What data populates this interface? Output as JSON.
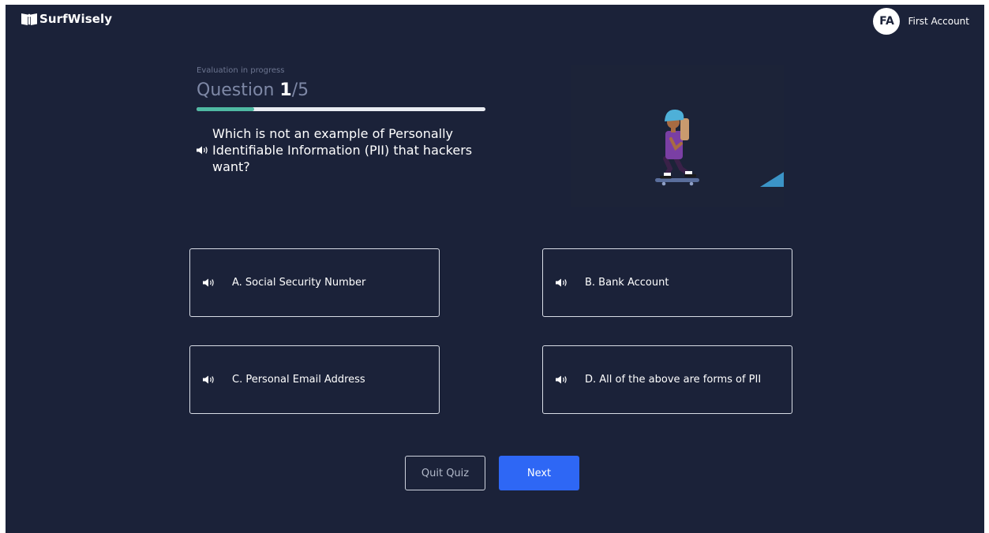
{
  "brand": {
    "name": "SurfWisely"
  },
  "user": {
    "initials": "FA",
    "name": "First Account"
  },
  "quiz": {
    "status": "Evaluation in progress",
    "question_label": "Question ",
    "current": "1",
    "separator": "/",
    "total": "5",
    "progress_fraction": 0.2,
    "question": "Which is not an example of Personally Identifiable Information (PII) that hackers want?"
  },
  "options": [
    {
      "label": "A. Social Security Number"
    },
    {
      "label": "B. Bank Account"
    },
    {
      "label": "C. Personal Email Address"
    },
    {
      "label": "D. All of the above are forms of PII"
    }
  ],
  "buttons": {
    "quit": "Quit Quiz",
    "next": "Next"
  },
  "icons": {
    "speaker": "speaker-icon",
    "logo": "logo-icon"
  },
  "colors": {
    "background": "#1b2239",
    "progress_fill": "#4fb9a3",
    "progress_track": "#e9ecf2",
    "next_button": "#2e67f5"
  }
}
